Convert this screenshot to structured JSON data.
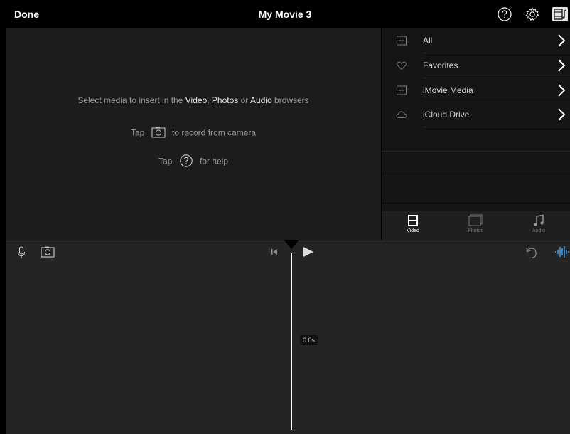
{
  "topbar": {
    "done_label": "Done",
    "title": "My Movie 3",
    "icons": [
      "help-icon",
      "settings-icon",
      "media-browser-icon"
    ]
  },
  "viewer": {
    "line1": {
      "prefix": "Select media to insert in the ",
      "video": "Video",
      "sep1": ", ",
      "photos": "Photos",
      "sep2": " or ",
      "audio": "Audio",
      "suffix": " browsers"
    },
    "line2": {
      "before": "Tap",
      "after": "to record from camera"
    },
    "line3": {
      "before": "Tap",
      "after": "for help"
    }
  },
  "browser": {
    "items": [
      {
        "label": "All",
        "icon": "film-icon"
      },
      {
        "label": "Favorites",
        "icon": "heart-icon"
      },
      {
        "label": "iMovie Media",
        "icon": "film-icon"
      },
      {
        "label": "iCloud Drive",
        "icon": "cloud-icon"
      }
    ],
    "tabs": [
      {
        "label": "Video",
        "active": true
      },
      {
        "label": "Photos",
        "active": false
      },
      {
        "label": "Audio",
        "active": false
      }
    ]
  },
  "timeline": {
    "duration": "0.0s"
  },
  "colors": {
    "accent": "#3aa8ff",
    "background": "#000000",
    "panel": "#1c1c1c",
    "timeline": "#242424"
  }
}
